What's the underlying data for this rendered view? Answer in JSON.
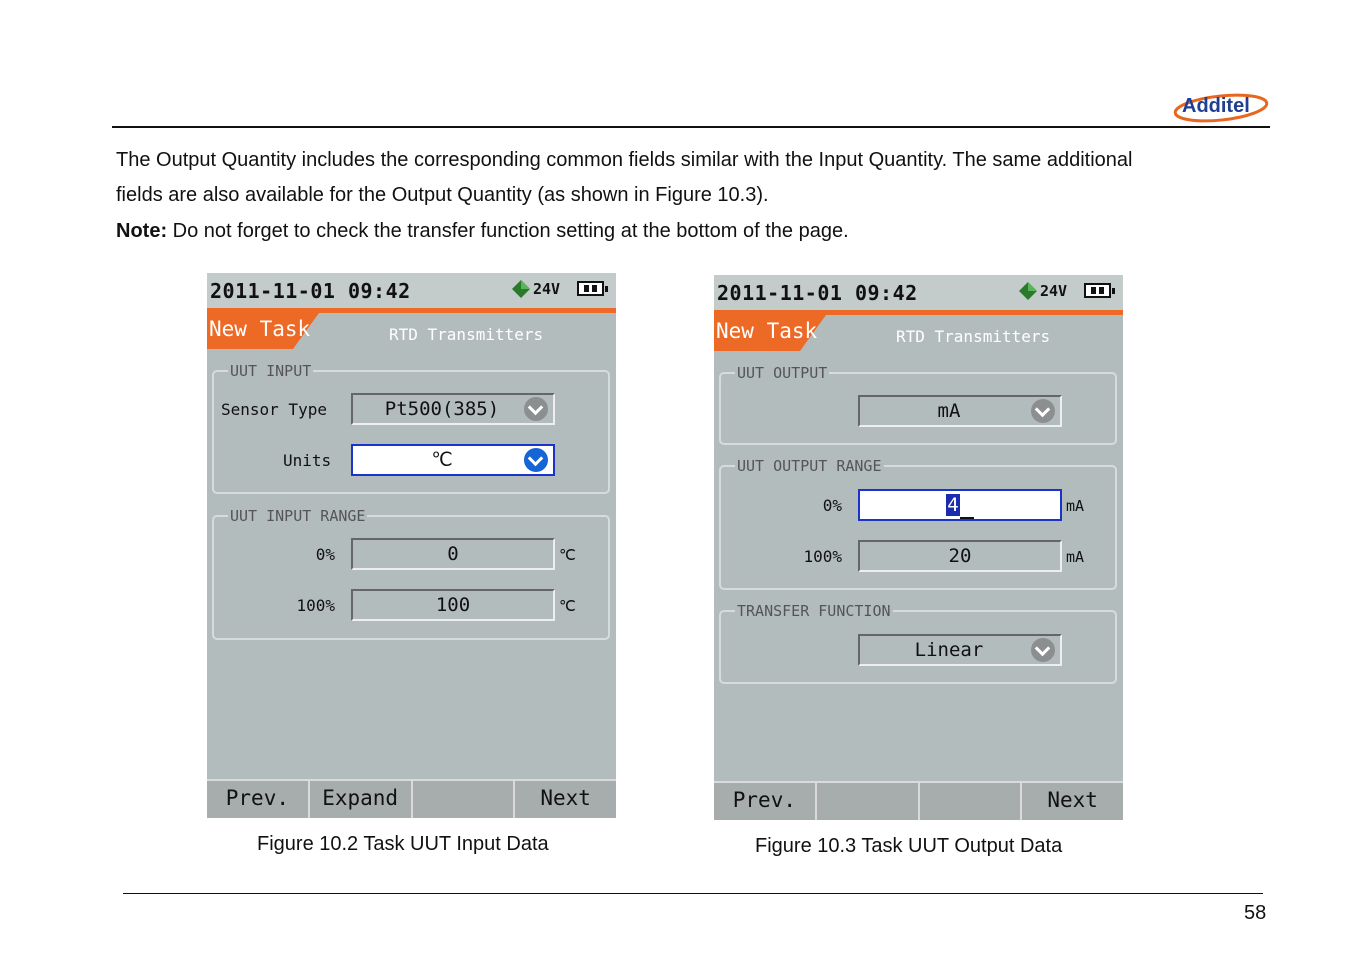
{
  "header": {
    "logo_text": "Additel"
  },
  "body": {
    "paragraph_line1": "The Output Quantity includes the corresponding common fields similar with the Input Quantity. The same additional",
    "paragraph_line2": "fields are also available for the Output Quantity (as shown in Figure 10.3).",
    "note_label": "Note:",
    "note_text": " Do not forget to check the transfer function setting at the bottom of the page."
  },
  "figure1": {
    "datetime": "2011-11-01 09:42",
    "voltage": "24V",
    "tab_label": "New Task",
    "subtitle": "RTD Transmitters",
    "group1_title": "UUT INPUT",
    "sensor_type_label": "Sensor Type",
    "sensor_type_value": "Pt500(385)",
    "units_label": "Units",
    "units_value": "℃",
    "group2_title": "UUT INPUT RANGE",
    "zero_label": "0%",
    "zero_value": "0",
    "zero_unit": "℃",
    "full_label": "100%",
    "full_value": "100",
    "full_unit": "℃",
    "softkeys": [
      "Prev.",
      "Expand",
      "",
      "Next"
    ],
    "caption": "Figure 10.2 Task UUT Input Data"
  },
  "figure2": {
    "datetime": "2011-11-01 09:42",
    "voltage": "24V",
    "tab_label": "New Task",
    "subtitle": "RTD Transmitters",
    "group1_title": "UUT OUTPUT",
    "output_value": "mA",
    "group2_title": "UUT OUTPUT RANGE",
    "zero_label": "0%",
    "zero_value": "4",
    "zero_unit": "mA",
    "full_label": "100%",
    "full_value": "20",
    "full_unit": "mA",
    "group3_title": "TRANSFER FUNCTION",
    "transfer_value": "Linear",
    "softkeys": [
      "Prev.",
      "",
      "",
      "Next"
    ],
    "caption": "Figure 10.3 Task UUT Output Data"
  },
  "footer": {
    "page_number": "58"
  }
}
